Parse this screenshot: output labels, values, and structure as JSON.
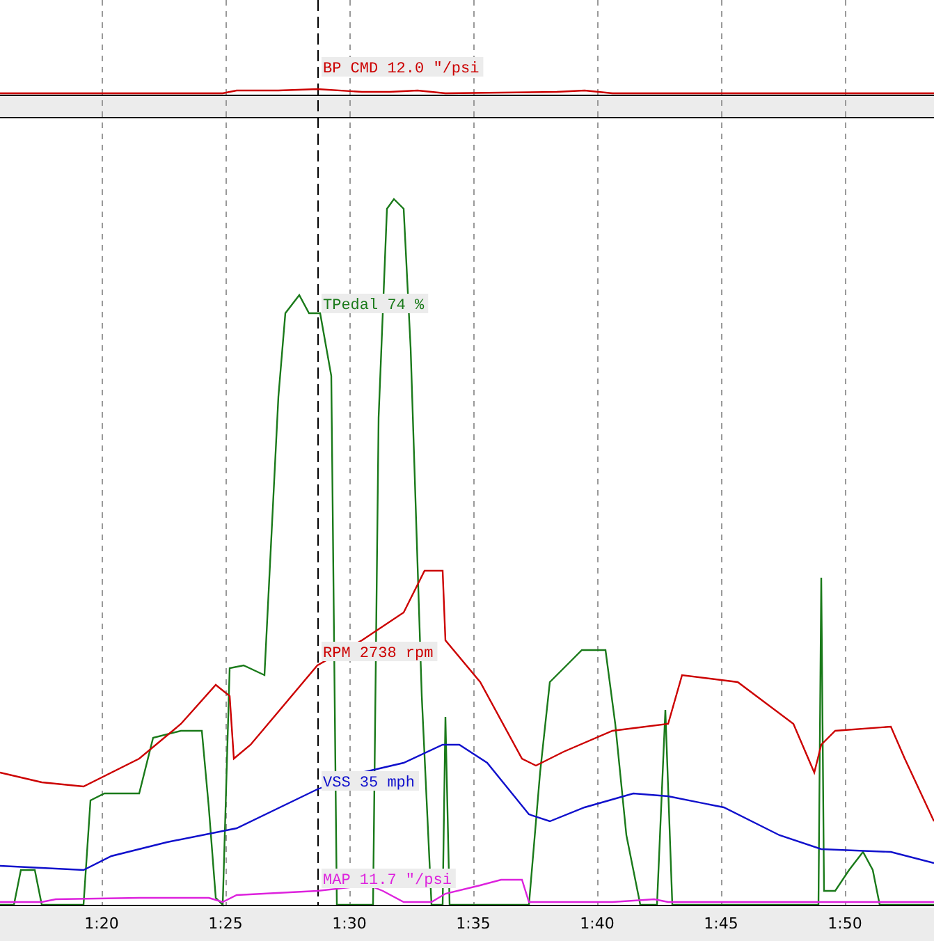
{
  "top_panel": {
    "channels": [
      {
        "label": "BP CMD 12.0 \"/psi",
        "color": "#cc0000"
      }
    ]
  },
  "main_panel": {
    "channels": [
      {
        "label": "TPedal 74 %",
        "color": "#1a7a1a"
      },
      {
        "label": "RPM 2738 rpm",
        "color": "#cc0000"
      },
      {
        "label": "VSS 35 mph",
        "color": "#1010cc"
      },
      {
        "label": "MAP 11.7 \"/psi",
        "color": "#dd22dd"
      }
    ]
  },
  "time_axis": {
    "ticks": [
      "1:20",
      "1:25",
      "1:30",
      "1:35",
      "1:40",
      "1:45",
      "1:50"
    ]
  }
}
